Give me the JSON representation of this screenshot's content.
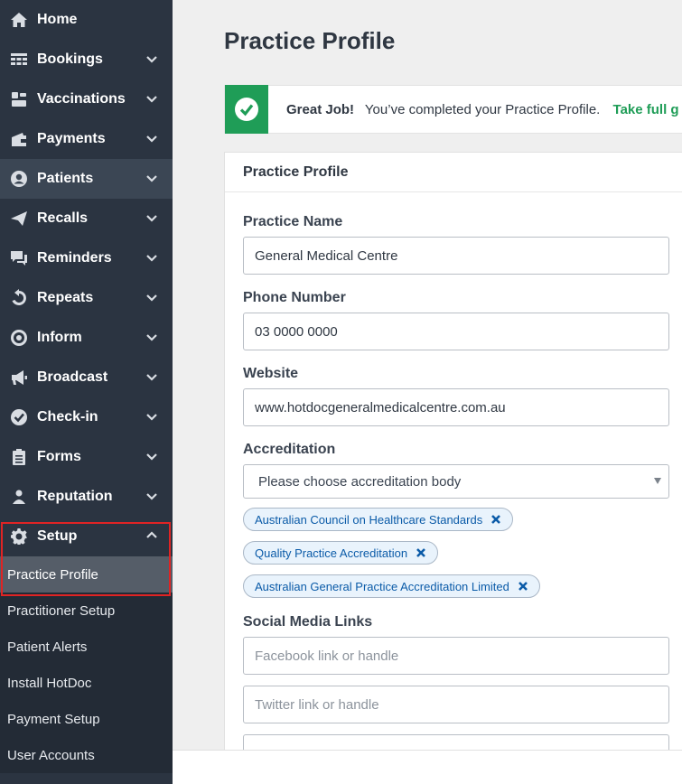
{
  "sidebar": {
    "items": [
      {
        "label": "Home",
        "icon": "home-icon",
        "chevron": false
      },
      {
        "label": "Bookings",
        "icon": "bookings-grid-icon",
        "chevron": true
      },
      {
        "label": "Vaccinations",
        "icon": "vaccine-icon",
        "chevron": true
      },
      {
        "label": "Payments",
        "icon": "wallet-icon",
        "chevron": true
      },
      {
        "label": "Patients",
        "icon": "user-circle-icon",
        "chevron": true
      },
      {
        "label": "Recalls",
        "icon": "paper-plane-icon",
        "chevron": true
      },
      {
        "label": "Reminders",
        "icon": "chat-icon",
        "chevron": true
      },
      {
        "label": "Repeats",
        "icon": "repeat-icon",
        "chevron": true
      },
      {
        "label": "Inform",
        "icon": "target-icon",
        "chevron": true
      },
      {
        "label": "Broadcast",
        "icon": "megaphone-icon",
        "chevron": true
      },
      {
        "label": "Check-in",
        "icon": "check-badge-icon",
        "chevron": true
      },
      {
        "label": "Forms",
        "icon": "clipboard-icon",
        "chevron": true
      },
      {
        "label": "Reputation",
        "icon": "person-star-icon",
        "chevron": true
      },
      {
        "label": "Setup",
        "icon": "gear-icon",
        "chevron": true
      }
    ],
    "setup_sub": [
      {
        "label": "Practice Profile"
      },
      {
        "label": "Practitioner Setup"
      },
      {
        "label": "Patient Alerts"
      },
      {
        "label": "Install HotDoc"
      },
      {
        "label": "Payment Setup"
      },
      {
        "label": "User Accounts"
      }
    ]
  },
  "main": {
    "page_title": "Practice Profile",
    "alert": {
      "bold": "Great Job!",
      "text": "You’ve completed your Practice Profile.",
      "link": "Take full g"
    },
    "card": {
      "title": "Practice Profile",
      "practice_name": {
        "label": "Practice Name",
        "value": "General Medical Centre"
      },
      "phone": {
        "label": "Phone Number",
        "value": "03 0000 0000"
      },
      "website": {
        "label": "Website",
        "value": "www.hotdocgeneralmedicalcentre.com.au"
      },
      "accreditation": {
        "label": "Accreditation",
        "placeholder": "Please choose accreditation body",
        "tags": [
          "Australian Council on Healthcare Standards",
          "Quality Practice Accreditation",
          "Australian General Practice Accreditation Limited"
        ]
      },
      "social": {
        "label": "Social Media Links",
        "facebook_placeholder": "Facebook link or handle",
        "twitter_placeholder": "Twitter link or handle"
      }
    }
  },
  "colors": {
    "sidebar_bg": "#2b3441",
    "success_green": "#1f9d57",
    "tag_blue": "#0b5ba8",
    "highlight_red": "#e02424"
  }
}
